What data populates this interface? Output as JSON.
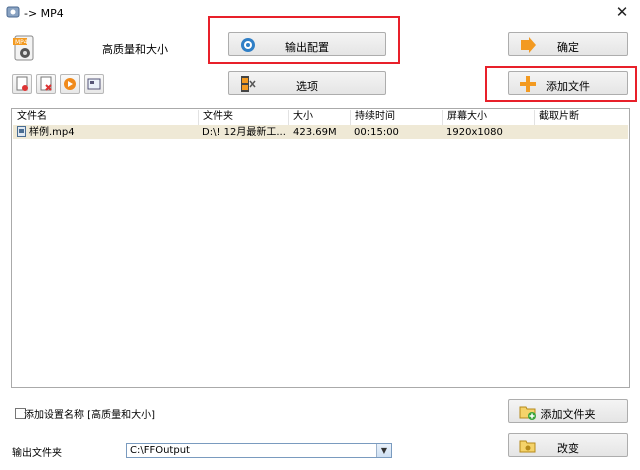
{
  "window": {
    "title": "-> MP4",
    "close_label": "✕"
  },
  "preset": {
    "label": "高质量和大小",
    "icon": "mp4-film-icon"
  },
  "buttons": {
    "output_config": "输出配置",
    "ok": "确定",
    "options": "选项",
    "add_file": "添加文件",
    "add_folder": "添加文件夹",
    "change": "改变"
  },
  "small_toolbar": [
    "add-item-icon",
    "remove-item-icon",
    "play-icon",
    "preview-icon"
  ],
  "file_list": {
    "columns": [
      "文件名",
      "文件夹",
      "大小",
      "持续时间",
      "屏幕大小",
      "截取片断"
    ],
    "rows": [
      {
        "name": "样例.mp4",
        "folder": "D:\\! 12月最新工...",
        "size": "423.69M",
        "duration": "00:15:00",
        "screen": "1920x1080",
        "clip": ""
      }
    ]
  },
  "save_setting": {
    "label": "添加设置名称 [高质量和大小]",
    "checked": false
  },
  "output_folder": {
    "label": "输出文件夹",
    "value": "C:\\FFOutput"
  },
  "colors": {
    "highlight_border": "#e8202a",
    "row_selected": "#efe9d6",
    "accent_orange": "#f39a21"
  }
}
